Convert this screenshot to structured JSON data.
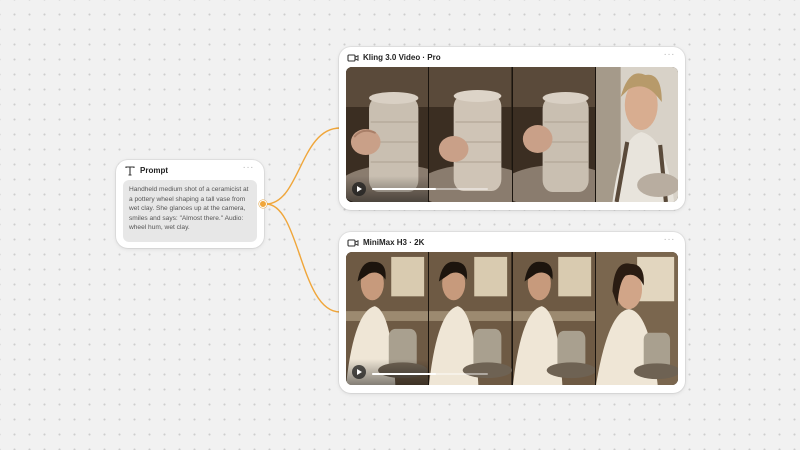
{
  "canvas": {
    "connector_color": "#f0a63a"
  },
  "prompt_node": {
    "title": "Prompt",
    "icon": "text-icon",
    "more": "···",
    "text": "Handheld medium shot of a ceramicist at a pottery wheel shaping a tall vase from wet clay. She glances up at the camera, smiles and says: \"Almost there.\" Audio: wheel hum, wet clay."
  },
  "video_nodes": [
    {
      "title": "Kling 3.0 Video · Pro",
      "icon": "video-camera-icon",
      "more": "···",
      "frames": [
        "vase-hands",
        "vase-hands",
        "vase-hands",
        "woman-at-camera"
      ],
      "progress": 0.55
    },
    {
      "title": "MiniMax H3 · 2K",
      "icon": "video-camera-icon",
      "more": "···",
      "frames": [
        "woman-at-wheel",
        "woman-at-wheel",
        "woman-at-wheel",
        "woman-at-camera"
      ],
      "progress": 0.55
    }
  ]
}
